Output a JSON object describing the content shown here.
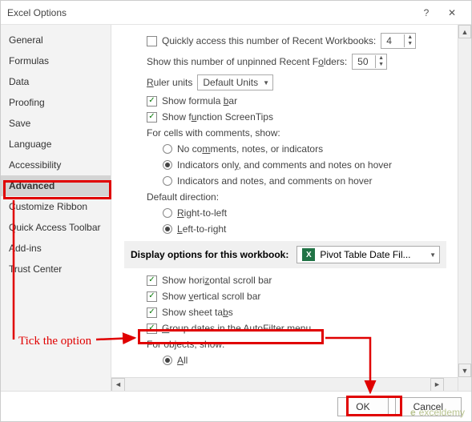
{
  "titlebar": {
    "title": "Excel Options"
  },
  "sidebar": {
    "items": [
      {
        "label": "General"
      },
      {
        "label": "Formulas"
      },
      {
        "label": "Data"
      },
      {
        "label": "Proofing"
      },
      {
        "label": "Save"
      },
      {
        "label": "Language"
      },
      {
        "label": "Accessibility"
      },
      {
        "label": "Advanced"
      },
      {
        "label": "Customize Ribbon"
      },
      {
        "label": "Quick Access Toolbar"
      },
      {
        "label": "Add-ins"
      },
      {
        "label": "Trust Center"
      }
    ]
  },
  "options": {
    "quickAccessRecent": "Quickly access this number of Recent Workbooks:",
    "quickAccessVal": "4",
    "unpinnedFolders": "Show this number of unpinned Recent Folders:",
    "unpinnedFoldersVal": "50",
    "rulerUnits": "Ruler units",
    "rulerUnitsVal": "Default Units",
    "showFormulaBar": "Show formula bar",
    "showScreenTips": "Show function ScreenTips",
    "commentsHead": "For cells with comments, show:",
    "commentsOpt1": "No comments, notes, or indicators",
    "commentsOpt2": "Indicators only, and comments and notes on hover",
    "commentsOpt3": "Indicators and notes, and comments on hover",
    "defaultDirHead": "Default direction:",
    "dirOpt1": "Right-to-left",
    "dirOpt2": "Left-to-right",
    "displaySection": "Display options for this workbook:",
    "workbookName": "Pivot Table Date Fil...",
    "showHScroll": "Show horizontal scroll bar",
    "showVScroll": "Show vertical scroll bar",
    "showSheetTabs": "Show sheet tabs",
    "groupDates": "Group dates in the AutoFilter menu",
    "forObjects": "For objects, show:",
    "objOpt1": "All"
  },
  "footer": {
    "ok": "OK",
    "cancel": "Cancel"
  },
  "annotation": {
    "tick": "Tick the option"
  },
  "watermark": "exceldemy"
}
